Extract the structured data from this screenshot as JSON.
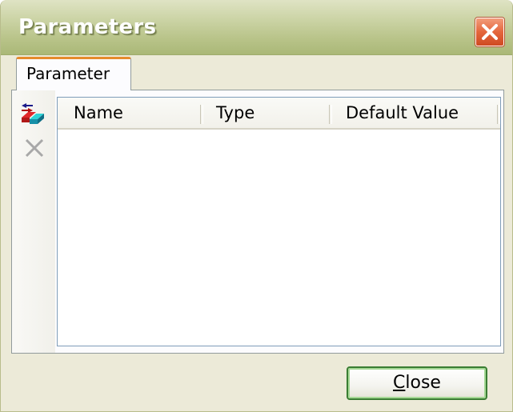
{
  "window": {
    "title": "Parameters"
  },
  "tabs": [
    {
      "label": "Parameter",
      "selected": true
    }
  ],
  "toolbar": {
    "buttons": [
      {
        "icon": "add-parameter-icon",
        "enabled": true
      },
      {
        "icon": "delete-icon",
        "enabled": false
      }
    ]
  },
  "grid": {
    "columns": [
      "Name",
      "Type",
      "Default Value"
    ],
    "rows": []
  },
  "footer": {
    "close_mnemonic": "C",
    "close_rest": "lose"
  },
  "colors": {
    "titlebar": "#b9c48a",
    "window_bg": "#ecead8",
    "tab_accent": "#e68b2c",
    "close_icon_bg": "#e4663c",
    "button_border": "#3a7d33"
  }
}
